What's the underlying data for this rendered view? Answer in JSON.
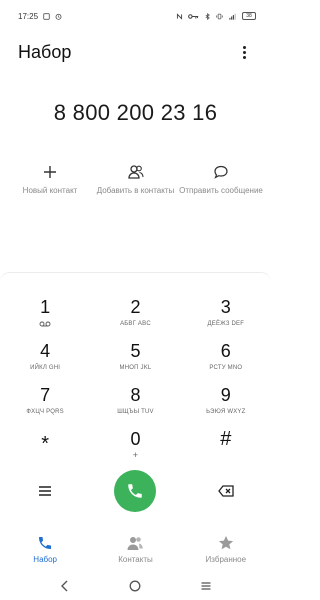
{
  "status_bar": {
    "time": "17:25",
    "battery": "38"
  },
  "appbar": {
    "title": "Набор"
  },
  "number": "8 800 200 23 16",
  "actions": [
    {
      "icon": "plus-icon",
      "label": "Новый контакт"
    },
    {
      "icon": "add-contact-icon",
      "label": "Добавить в контакты"
    },
    {
      "icon": "message-icon",
      "label": "Отправить сообщение"
    }
  ],
  "keys": [
    [
      {
        "digit": "1",
        "sub": "voicemail-icon"
      },
      {
        "digit": "2",
        "sub": "АБВГ ABC"
      },
      {
        "digit": "3",
        "sub": "ДЕЁЖЗ DEF"
      }
    ],
    [
      {
        "digit": "4",
        "sub": "ИЙКЛ GHI"
      },
      {
        "digit": "5",
        "sub": "МНОП JKL"
      },
      {
        "digit": "6",
        "sub": "РСТУ MNO"
      }
    ],
    [
      {
        "digit": "7",
        "sub": "ФХЦЧ PQRS"
      },
      {
        "digit": "8",
        "sub": "ШЩЪЫ TUV"
      },
      {
        "digit": "9",
        "sub": "ЬЭЮЯ WXYZ"
      }
    ],
    [
      {
        "digit": "*",
        "sub": ""
      },
      {
        "digit": "0",
        "sub": "+"
      },
      {
        "digit": "#",
        "sub": ""
      }
    ]
  ],
  "tabs": [
    {
      "label": "Набор",
      "icon": "phone-icon",
      "active": true
    },
    {
      "label": "Контакты",
      "icon": "contacts-icon",
      "active": false
    },
    {
      "label": "Избранное",
      "icon": "star-icon",
      "active": false
    }
  ],
  "colors": {
    "call_green": "#3cb25a",
    "active_blue": "#1f6fd1",
    "muted_text": "#8a8a8a"
  }
}
